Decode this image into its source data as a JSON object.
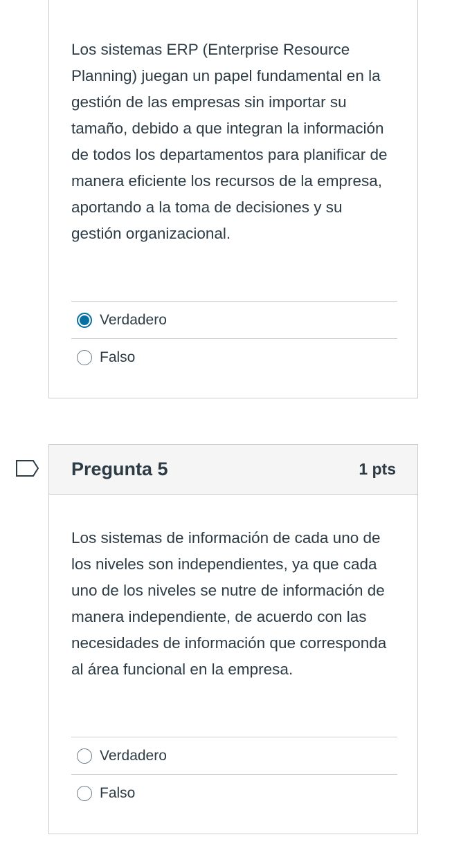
{
  "previous_question": {
    "text": "Los sistemas ERP (Enterprise Resource Planning) juegan un papel fundamental en la gestión de las empresas sin importar su tamaño, debido a que integran la información de todos los departamentos para planificar de manera eficiente los recursos de la empresa, aportando a la toma de decisiones y su gestión organizacional.",
    "answers": [
      {
        "label": "Verdadero",
        "selected": true
      },
      {
        "label": "Falso",
        "selected": false
      }
    ]
  },
  "question5": {
    "title": "Pregunta 5",
    "points": "1 pts",
    "text": "Los sistemas de información de cada uno de los niveles son independientes, ya que cada uno de los niveles se nutre de información de manera independiente, de acuerdo con las necesidades de información que corresponda al área funcional en la empresa.",
    "answers": [
      {
        "label": "Verdadero",
        "selected": false
      },
      {
        "label": "Falso",
        "selected": false
      }
    ]
  },
  "colors": {
    "accent": "#0770a3",
    "text": "#2d3b45",
    "border": "#c7cdd1",
    "header_bg": "#f5f5f5"
  },
  "icons": {
    "flag": "flag-question-icon"
  }
}
